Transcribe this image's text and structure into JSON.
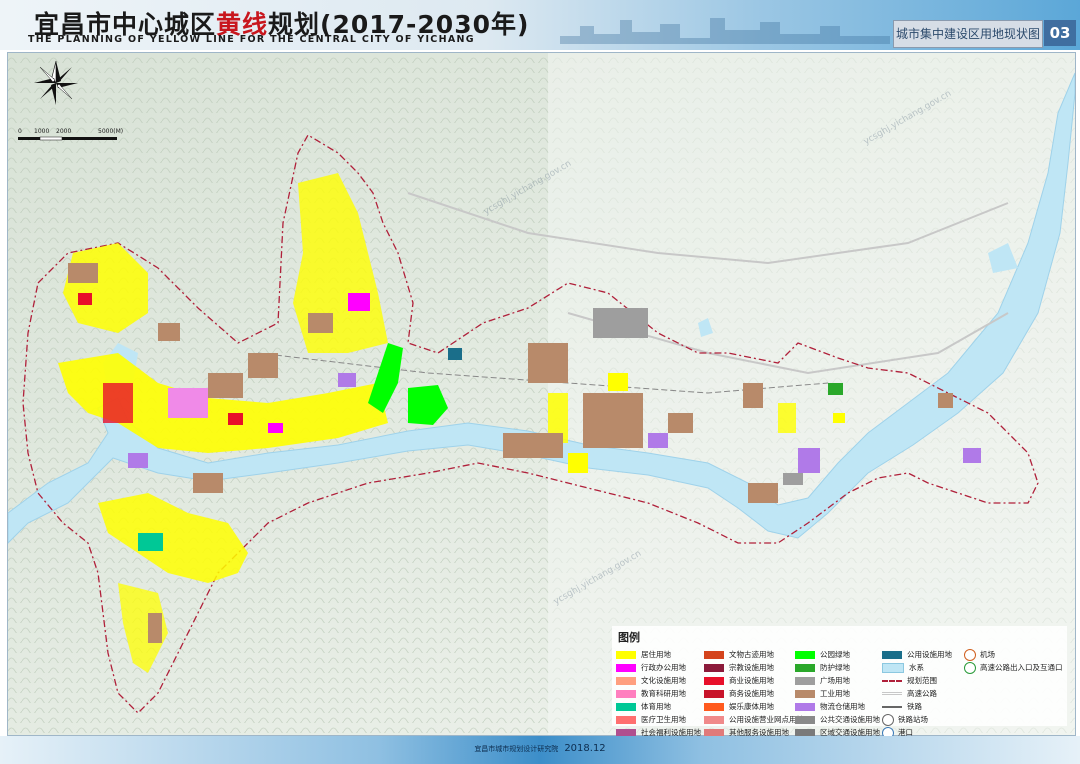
{
  "header": {
    "title_part1": "宜昌市中心城区",
    "title_highlight": "黄线",
    "title_part2": "规划(2017-2030年)",
    "title_en": "THE PLANNING OF YELLOW LINE FOR THE CENTRAL CITY OF YICHANG",
    "sheet_name": "城市集中建设区用地现状图",
    "sheet_number": "03"
  },
  "scale_bar": {
    "labels": [
      "0",
      "1000",
      "2000",
      "5000(M)"
    ]
  },
  "watermark": "ycsghj.yichang.gov.cn",
  "legend": {
    "title": "图例",
    "columns": [
      [
        {
          "label": "居住用地",
          "color": "#ffff00"
        },
        {
          "label": "行政办公用地",
          "color": "#ff00ff"
        },
        {
          "label": "文化设施用地",
          "color": "#ff9f7f"
        },
        {
          "label": "教育科研用地",
          "color": "#ff7fbf"
        },
        {
          "label": "体育用地",
          "color": "#00c896"
        },
        {
          "label": "医疗卫生用地",
          "color": "#ff6f6f"
        },
        {
          "label": "社会福利设施用地",
          "color": "#b04f8f"
        }
      ],
      [
        {
          "label": "文物古迹用地",
          "color": "#d4441c"
        },
        {
          "label": "宗教设施用地",
          "color": "#8b1a3a"
        },
        {
          "label": "商业设施用地",
          "color": "#e8102a"
        },
        {
          "label": "商务设施用地",
          "color": "#c8142a"
        },
        {
          "label": "娱乐康体用地",
          "color": "#ff5a1e"
        },
        {
          "label": "公用设施营业网点用地",
          "color": "#f08a8a"
        },
        {
          "label": "其他服务设施用地",
          "color": "#e07a7a"
        }
      ],
      [
        {
          "label": "公园绿地",
          "color": "#00ff00"
        },
        {
          "label": "防护绿地",
          "color": "#2aa82a"
        },
        {
          "label": "广场用地",
          "color": "#9e9e9e"
        },
        {
          "label": "工业用地",
          "color": "#b88a6a"
        },
        {
          "label": "物流仓储用地",
          "color": "#b07ae8"
        },
        {
          "label": "公共交通设施用地",
          "color": "#8a8a8a"
        },
        {
          "label": "区域交通设施用地",
          "color": "#7a7a7a"
        }
      ],
      [
        {
          "label": "公用设施用地",
          "color": "#1a6e8a"
        },
        {
          "label": "水系",
          "color": "#bfe6f5"
        },
        {
          "label": "规划范围",
          "color": "#b0203a"
        },
        {
          "label": "高速公路",
          "color": "#c8c8c8"
        },
        {
          "label": "铁路",
          "color": "#666666"
        },
        {
          "label": "铁路站场",
          "color": "#666666"
        },
        {
          "label": "港口",
          "color": "#3a7ab8"
        }
      ],
      [
        {
          "label": "机场",
          "color": "#d06020"
        },
        {
          "label": "高速公路出入口及互通口",
          "color": "#2a9a3a"
        }
      ]
    ]
  },
  "footer": {
    "org": "宜昌市城市规划设计研究院",
    "date": "2018.12"
  }
}
